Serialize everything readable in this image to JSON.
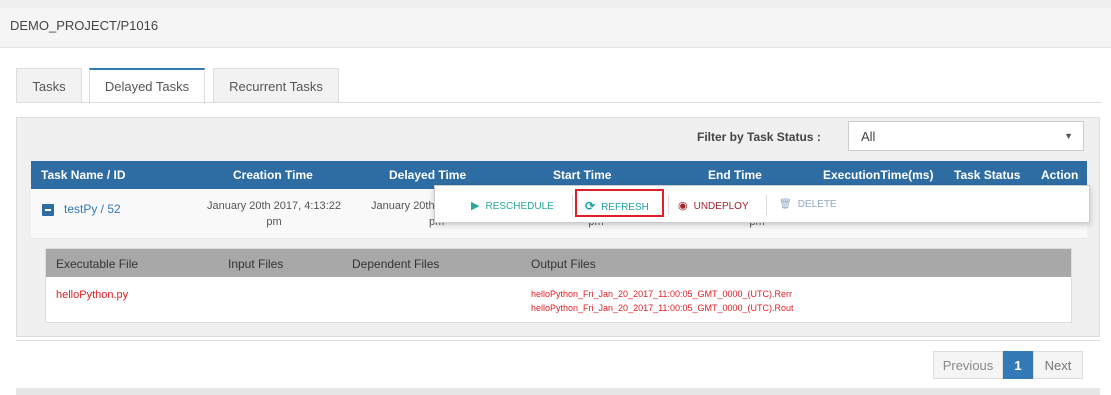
{
  "breadcrumb": "DEMO_PROJECT/P1016",
  "tabs": [
    "Tasks",
    "Delayed Tasks",
    "Recurrent Tasks"
  ],
  "active_tab": "Delayed Tasks",
  "filter": {
    "label": "Filter by Task Status :",
    "value": "All"
  },
  "table": {
    "columns": [
      "Task Name / ID",
      "Creation Time",
      "Delayed Time",
      "Start Time",
      "End Time",
      "ExecutionTime(ms)",
      "Task Status",
      "Action"
    ],
    "row": {
      "task": "testPy / 52",
      "creation_time_line1": "January 20th 2017, 4:13:22",
      "creation_time_line2": "pm",
      "delayed_time_line1": "January 20th",
      "pm_fragment": "pm"
    }
  },
  "actions": {
    "reschedule": "RESCHEDULE",
    "refresh": "REFRESH",
    "undeploy": "UNDEPLOY",
    "delete": "DELETE"
  },
  "files": {
    "headers": [
      "Executable File",
      "Input Files",
      "Dependent Files",
      "Output Files"
    ],
    "executable": "helloPython.py",
    "outputs": [
      "helloPython_Fri_Jan_20_2017_11:00:05_GMT_0000_(UTC).Rerr",
      "helloPython_Fri_Jan_20_2017_11:00:05_GMT_0000_(UTC).Rout"
    ]
  },
  "pagination": {
    "previous": "Previous",
    "current": "1",
    "next": "Next"
  },
  "colors": {
    "header_blue": "#2e6da4",
    "link_blue": "#337ab7",
    "play_teal": "#2aa89a",
    "refresh_teal": "#20a0a8",
    "undeploy_red": "#a5232b",
    "delete_muted": "#8fa8c8",
    "highlight_red": "#e01f26"
  }
}
